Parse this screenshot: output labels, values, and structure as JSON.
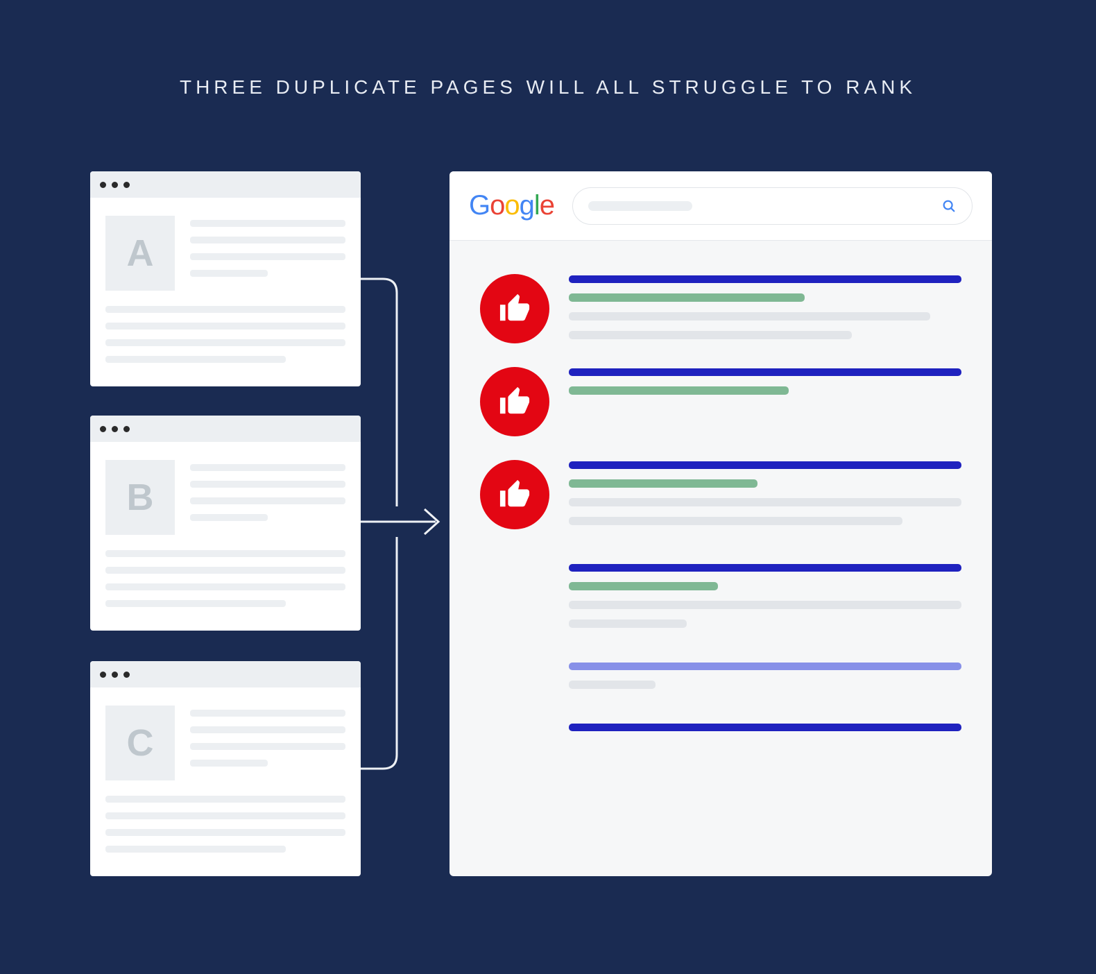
{
  "title": "THREE DUPLICATE PAGES WILL ALL STRUGGLE TO RANK",
  "pages": {
    "a": {
      "label": "A"
    },
    "b": {
      "label": "B"
    },
    "c": {
      "label": "C"
    }
  },
  "serp": {
    "logo_text": "Google"
  }
}
